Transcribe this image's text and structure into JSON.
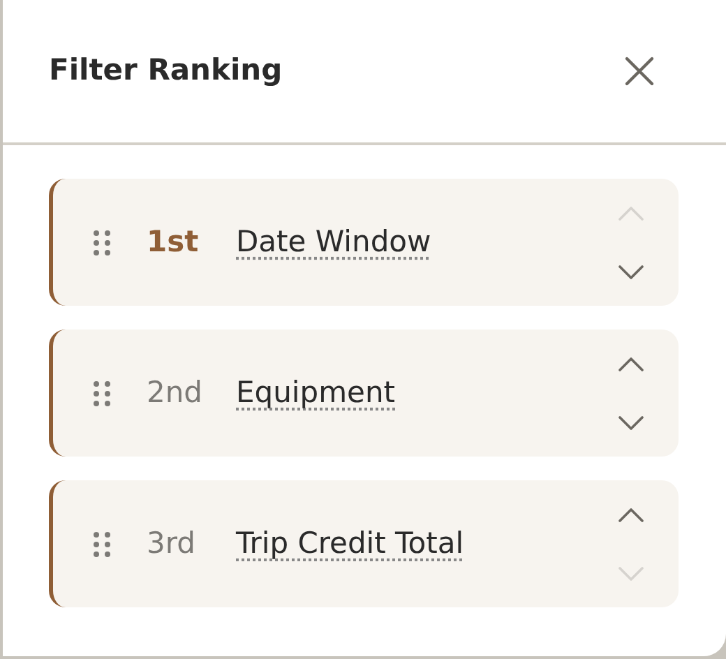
{
  "panel": {
    "title": "Filter Ranking"
  },
  "items": [
    {
      "rank": "1st",
      "label": "Date Window",
      "highlighted": true,
      "move_up": {
        "disabled": true
      },
      "move_down": {
        "disabled": false
      }
    },
    {
      "rank": "2nd",
      "label": "Equipment",
      "highlighted": false,
      "move_up": {
        "disabled": false
      },
      "move_down": {
        "disabled": false
      }
    },
    {
      "rank": "3rd",
      "label": "Trip Credit Total",
      "highlighted": false,
      "move_up": {
        "disabled": false
      },
      "move_down": {
        "disabled": true
      }
    }
  ]
}
